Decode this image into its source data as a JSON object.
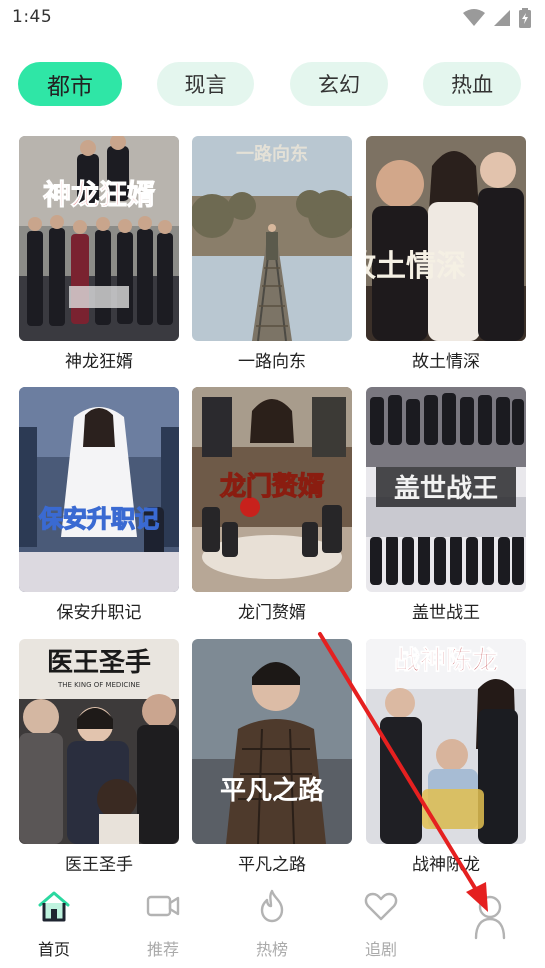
{
  "status_bar": {
    "time": "1:45"
  },
  "categories": [
    {
      "label": "都市",
      "active": true
    },
    {
      "label": "现言",
      "active": false
    },
    {
      "label": "玄幻",
      "active": false
    },
    {
      "label": "热血",
      "active": false
    }
  ],
  "dramas": [
    {
      "title": "神龙狂婿",
      "poster_text": "神龙狂婿"
    },
    {
      "title": "一路向东",
      "poster_text": "一路向东"
    },
    {
      "title": "故土情深",
      "poster_text": "故土情深"
    },
    {
      "title": "保安升职记",
      "poster_text": "保安升职记"
    },
    {
      "title": "龙门赘婿",
      "poster_text": "龙门赘婿"
    },
    {
      "title": "盖世战王",
      "poster_text": "盖世战王"
    },
    {
      "title": "医王圣手",
      "poster_text": "医王圣手",
      "poster_subtext": "THE KING OF MEDICINE"
    },
    {
      "title": "平凡之路",
      "poster_text": "平凡之路"
    },
    {
      "title": "战神陈龙",
      "poster_text": "战神陈龙"
    }
  ],
  "bottom_nav": [
    {
      "label": "首页",
      "icon": "home-icon",
      "active": true
    },
    {
      "label": "推荐",
      "icon": "video-camera-icon",
      "active": false
    },
    {
      "label": "热榜",
      "icon": "flame-icon",
      "active": false
    },
    {
      "label": "追剧",
      "icon": "heart-icon",
      "active": false
    },
    {
      "label": "",
      "icon": "profile-icon",
      "active": false
    }
  ],
  "colors": {
    "accent": "#2fe6a6",
    "chip_background": "#e4f6ee",
    "annotation_arrow": "#e52020"
  }
}
